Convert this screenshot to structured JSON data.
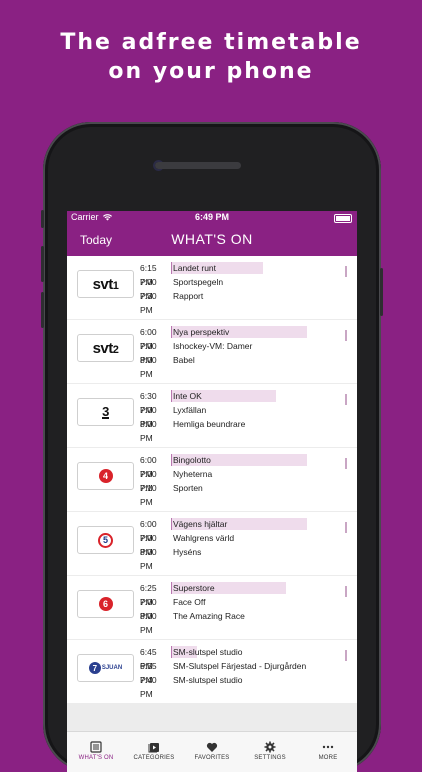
{
  "headline": {
    "line1": "The adfree timetable",
    "line2": "on your phone"
  },
  "status": {
    "carrier": "Carrier",
    "time": "6:49 PM"
  },
  "nav": {
    "left": "Today",
    "title": "WHAT'S ON"
  },
  "channels": [
    {
      "logo": "svt1",
      "programs": [
        {
          "time": "6:15 PM",
          "title": "Landet runt"
        },
        {
          "time": "7:00 PM",
          "title": "Sportspegeln"
        },
        {
          "time": "7:30 PM",
          "title": "Rapport"
        }
      ],
      "progress": 0.55
    },
    {
      "logo": "svt2",
      "programs": [
        {
          "time": "6:00 PM",
          "title": "Nya perspektiv"
        },
        {
          "time": "7:00 PM",
          "title": "Ishockey-VM: Damer"
        },
        {
          "time": "8:00 PM",
          "title": "Babel"
        }
      ],
      "progress": 0.82
    },
    {
      "logo": "3",
      "programs": [
        {
          "time": "6:30 PM",
          "title": "Inte OK"
        },
        {
          "time": "7:00 PM",
          "title": "Lyxfällan"
        },
        {
          "time": "8:00 PM",
          "title": "Hemliga beundrare"
        }
      ],
      "progress": 0.63
    },
    {
      "logo": "4",
      "programs": [
        {
          "time": "6:00 PM",
          "title": "Bingolotto"
        },
        {
          "time": "7:00 PM",
          "title": "Nyheterna"
        },
        {
          "time": "7:10 PM",
          "title": "Sporten"
        }
      ],
      "progress": 0.82
    },
    {
      "logo": "5",
      "programs": [
        {
          "time": "6:00 PM",
          "title": "Vägens hjältar"
        },
        {
          "time": "7:00 PM",
          "title": "Wahlgrens värld"
        },
        {
          "time": "8:00 PM",
          "title": "Hyséns"
        }
      ],
      "progress": 0.82
    },
    {
      "logo": "6",
      "programs": [
        {
          "time": "6:25 PM",
          "title": "Superstore"
        },
        {
          "time": "7:00 PM",
          "title": "Face Off"
        },
        {
          "time": "8:00 PM",
          "title": "The Amazing Race"
        }
      ],
      "progress": 0.69
    },
    {
      "logo": "SJUAN",
      "programs": [
        {
          "time": "6:45 PM",
          "title": "SM-slutspel studio"
        },
        {
          "time": "6:55 PM",
          "title": "SM-Slutspel Färjestad - Djurgården"
        },
        {
          "time": "7:40 PM",
          "title": "SM-slutspel studio"
        }
      ],
      "progress": 0.15
    }
  ],
  "tabs": [
    {
      "label": "WHAT'S ON",
      "icon": "list-icon",
      "active": true
    },
    {
      "label": "CATEGORIES",
      "icon": "play-stack-icon"
    },
    {
      "label": "FAVORITES",
      "icon": "heart-icon"
    },
    {
      "label": "SETTINGS",
      "icon": "gear-icon"
    },
    {
      "label": "MORE",
      "icon": "ellipsis-icon"
    }
  ],
  "colors": {
    "brand": "#8a2183",
    "now_highlight": "#efdcec",
    "background": "#ececec"
  }
}
